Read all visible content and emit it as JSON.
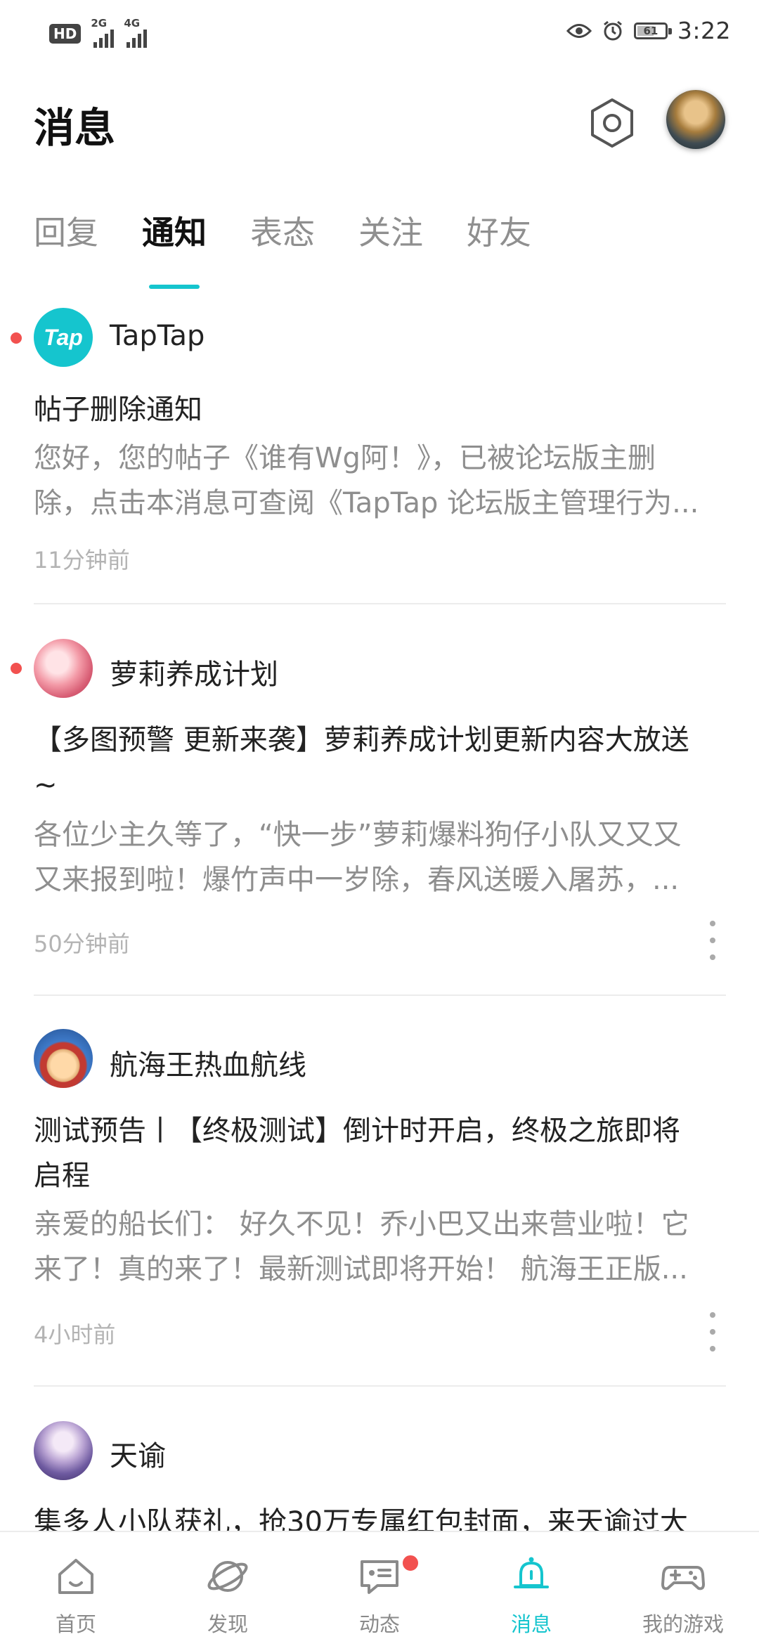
{
  "status_bar": {
    "hd": "HD",
    "hd_sub": "2",
    "net_1": "2G",
    "net_2": "4G",
    "battery": "61",
    "battery_level": 0.61,
    "time": "3:22"
  },
  "header": {
    "title": "消息",
    "settings_icon": "hexagon-gear-icon",
    "avatar": "user-avatar"
  },
  "tabs": [
    {
      "label": "回复",
      "active": false
    },
    {
      "label": "通知",
      "active": true
    },
    {
      "label": "表态",
      "active": false
    },
    {
      "label": "关注",
      "active": false
    },
    {
      "label": "好友",
      "active": false
    }
  ],
  "notifications": [
    {
      "source": "TapTap",
      "avatar_text": "Tap",
      "unread": true,
      "title": "帖子删除通知",
      "summary_lines": [
        "您好，您的帖子《谁有Wg阿！》，已被论坛版主删",
        "除，点击本消息可查阅《TapTap 论坛版主管理行为..."
      ],
      "time": "11分钟前"
    },
    {
      "source": "萝莉养成计划",
      "unread": true,
      "title_lines": [
        "【多图预警 更新来袭】萝莉养成计划更新内容大放送",
        "~"
      ],
      "summary_lines": [
        "各位少主久等了，“快一步”萝莉爆料狗仔小队又又又",
        "又来报到啦！爆竹声中一岁除，春风送暖入屠苏，..."
      ],
      "time": "50分钟前"
    },
    {
      "source": "航海王热血航线",
      "unread": false,
      "title_lines": [
        "测试预告丨【终极测试】倒计时开启，终极之旅即将",
        "启程"
      ],
      "summary_lines": [
        "亲爱的船长们： 好久不见！乔小巴又出来营业啦！它",
        "来了！真的来了！最新测试即将开始！ 航海王正版..."
      ],
      "time": "4小时前"
    },
    {
      "source": "天谕",
      "unread": false,
      "title_lines": [
        "集多人小队获礼，抢30万专属红包封面，来天谕过大"
      ],
      "summary_lines": [],
      "time": ""
    }
  ],
  "bottom_nav": [
    {
      "label": "首页",
      "icon": "home-icon",
      "active": false
    },
    {
      "label": "发现",
      "icon": "planet-icon",
      "active": false
    },
    {
      "label": "动态",
      "icon": "chat-icon",
      "active": false,
      "badge": true
    },
    {
      "label": "消息",
      "icon": "bell-icon",
      "active": true
    },
    {
      "label": "我的游戏",
      "icon": "gamepad-icon",
      "active": false
    }
  ],
  "colors": {
    "accent": "#15c5ce",
    "unread_dot": "#f2514f",
    "title": "#111111",
    "secondary_text": "#8e8e8e",
    "time_text": "#b3b3b3"
  }
}
